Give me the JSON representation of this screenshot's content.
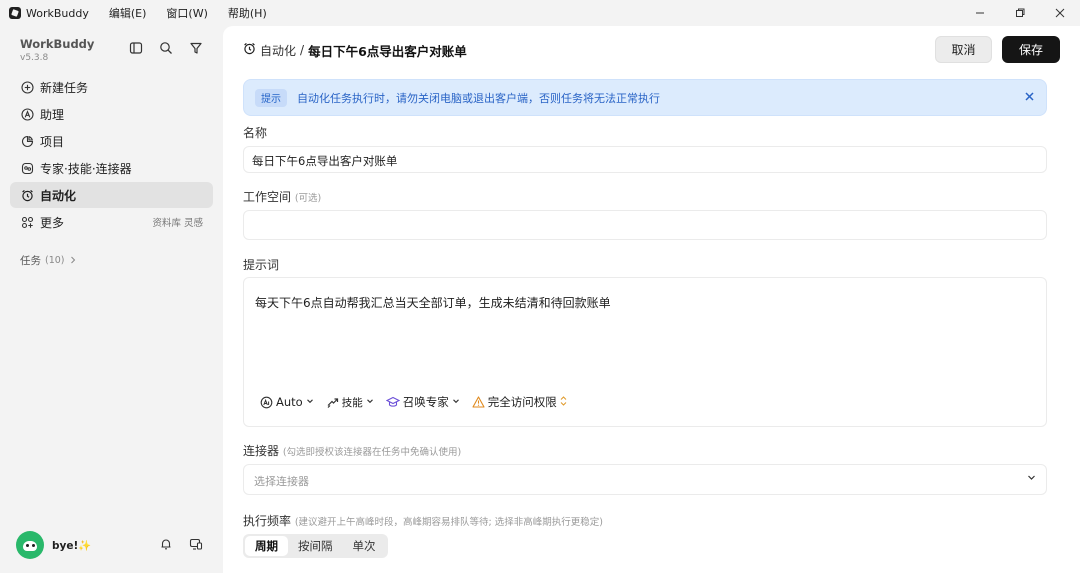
{
  "titlebar": {
    "app_name": "WorkBuddy",
    "menus": [
      "编辑(E)",
      "窗口(W)",
      "帮助(H)"
    ],
    "controls": [
      "minimize-icon",
      "restore-icon",
      "close-icon"
    ]
  },
  "sidebar": {
    "brand": "WorkBuddy",
    "version": "v5.3.8",
    "tools": [
      "sidebar-toggle-icon",
      "search-icon",
      "filter-icon"
    ],
    "items": [
      {
        "label": "新建任务",
        "icon": "plus-circle-icon",
        "extra": ""
      },
      {
        "label": "助理",
        "icon": "assistant-icon",
        "extra": ""
      },
      {
        "label": "项目",
        "icon": "project-icon",
        "extra": ""
      },
      {
        "label": "专家·技能·连接器",
        "icon": "expert-icon",
        "extra": ""
      },
      {
        "label": "自动化",
        "icon": "alarm-clock-icon",
        "extra": "",
        "active": true
      },
      {
        "label": "更多",
        "icon": "apps-icon",
        "extra": "资料库 灵感"
      }
    ],
    "tasks_label": "任务",
    "tasks_count": "(10)",
    "user_name": "bye!✨"
  },
  "main": {
    "breadcrumb": "自动化",
    "separator": "/",
    "title": "每日下午6点导出客户对账单",
    "cancel_label": "取消",
    "save_label": "保存",
    "notice": {
      "tag": "提示",
      "text": "自动化任务执行时，请勿关闭电脑或退出客户端，否则任务将无法正常执行"
    },
    "name_label": "名称",
    "name_value": "每日下午6点导出客户对账单",
    "workspace_label": "工作空间",
    "workspace_hint": "(可选)",
    "workspace_value": "",
    "prompt_label": "提示词",
    "prompt_value": "每天下午6点自动帮我汇总当天全部订单，生成未结清和待回款账单",
    "prompt_tools": {
      "model": "Auto",
      "skills": "技能",
      "experts": "召唤专家",
      "access": "完全访问权限"
    },
    "connector_label": "连接器",
    "connector_hint": "(勾选即授权该连接器在任务中免确认使用)",
    "connector_placeholder": "选择连接器",
    "frequency_label": "执行频率",
    "frequency_hint": "(建议避开上午高峰时段，高峰期容易排队等待; 选择非高峰期执行更稳定)",
    "frequency_tabs": [
      "周期",
      "按间隔",
      "单次"
    ]
  }
}
